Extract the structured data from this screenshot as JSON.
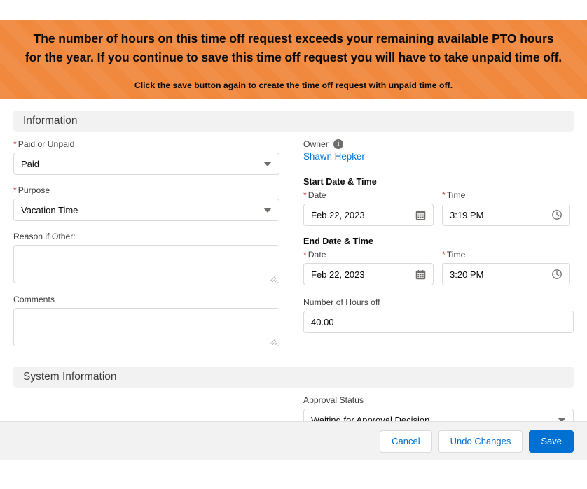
{
  "banner": {
    "message_line1": "The number of hours on this time off request exceeds your remaining available PTO hours",
    "message_line2": "for the year. If you continue to save this time off request you will have to take unpaid time off.",
    "sub_message": "Click the save button again to create the time off request with unpaid time off.",
    "background_color": "#f0883e",
    "text_color": "#0a0a0a"
  },
  "sections": {
    "information": {
      "title": "Information"
    },
    "system_information": {
      "title": "System Information"
    }
  },
  "fields": {
    "paid_or_unpaid": {
      "label": "Paid or Unpaid",
      "required_marker": "*",
      "value": "Paid",
      "icon": "chevron-down-icon"
    },
    "purpose": {
      "label": "Purpose",
      "required_marker": "*",
      "value": "Vacation Time",
      "icon": "chevron-down-icon"
    },
    "reason_if_other": {
      "label": "Reason if Other:",
      "value": ""
    },
    "comments": {
      "label": "Comments",
      "value": ""
    },
    "owner": {
      "label": "Owner",
      "info_icon": "info-icon",
      "value": "Shawn Hepker",
      "link_color": "#0070d2"
    },
    "start_group_title": "Start Date & Time",
    "start_date": {
      "label": "Date",
      "required_marker": "*",
      "value": "Feb 22, 2023",
      "icon": "calendar-icon"
    },
    "start_time": {
      "label": "Time",
      "required_marker": "*",
      "value": "3:19 PM",
      "icon": "clock-icon"
    },
    "end_group_title": "End Date & Time",
    "end_date": {
      "label": "Date",
      "required_marker": "*",
      "value": "Feb 22, 2023",
      "icon": "calendar-icon"
    },
    "end_time": {
      "label": "Time",
      "required_marker": "*",
      "value": "3:20 PM",
      "icon": "clock-icon"
    },
    "number_of_hours_off": {
      "label": "Number of Hours off",
      "value": "40.00"
    },
    "approval_status": {
      "label": "Approval Status",
      "value": "Waiting for Approval Decision",
      "icon": "chevron-down-icon"
    }
  },
  "footer": {
    "cancel_label": "Cancel",
    "undo_label": "Undo Changes",
    "save_label": "Save",
    "primary_color": "#0070d2"
  }
}
